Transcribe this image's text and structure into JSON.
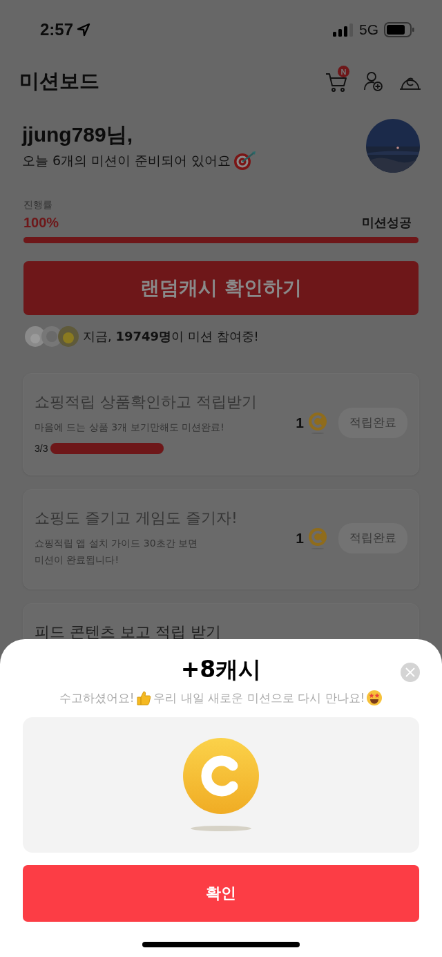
{
  "status_bar": {
    "time": "2:57",
    "network": "5G"
  },
  "header": {
    "title": "미션보드",
    "cart_badge": "N"
  },
  "greeting": {
    "name": "jjung789님,",
    "message": "오늘 6개의 미션이 준비되어 있어요"
  },
  "progress": {
    "label": "진행률",
    "percent": "100%",
    "status": "미션성공",
    "level": 1
  },
  "random_cash_button": "랜덤캐시 확인하기",
  "participants": "지금, **19749명**이 미션 참여중!",
  "missions": [
    {
      "title": "쇼핑적립 상품확인하고 적립받기",
      "description": "마음에 드는 상품 3개 보기만해도 미션완료!",
      "progress_text": "3/3",
      "level": 1,
      "reward": "1",
      "button": "적립완료",
      "completed": true
    },
    {
      "title": "쇼핑도 즐기고 게임도 즐기자!",
      "description": "쇼핑적립 앱 설치 가이드 30초간 보면\n미션이 완료됩니다!",
      "reward": "1",
      "button": "적립완료",
      "completed": true
    },
    {
      "title": "피드 콘텐츠 보고 적립 받기"
    }
  ],
  "sheet": {
    "title": "+8캐시",
    "message_parts": [
      "수고하셨어요!",
      "우리 내일 새로운 미션으로 다시 만나요!"
    ],
    "confirm_button": "확인"
  }
}
